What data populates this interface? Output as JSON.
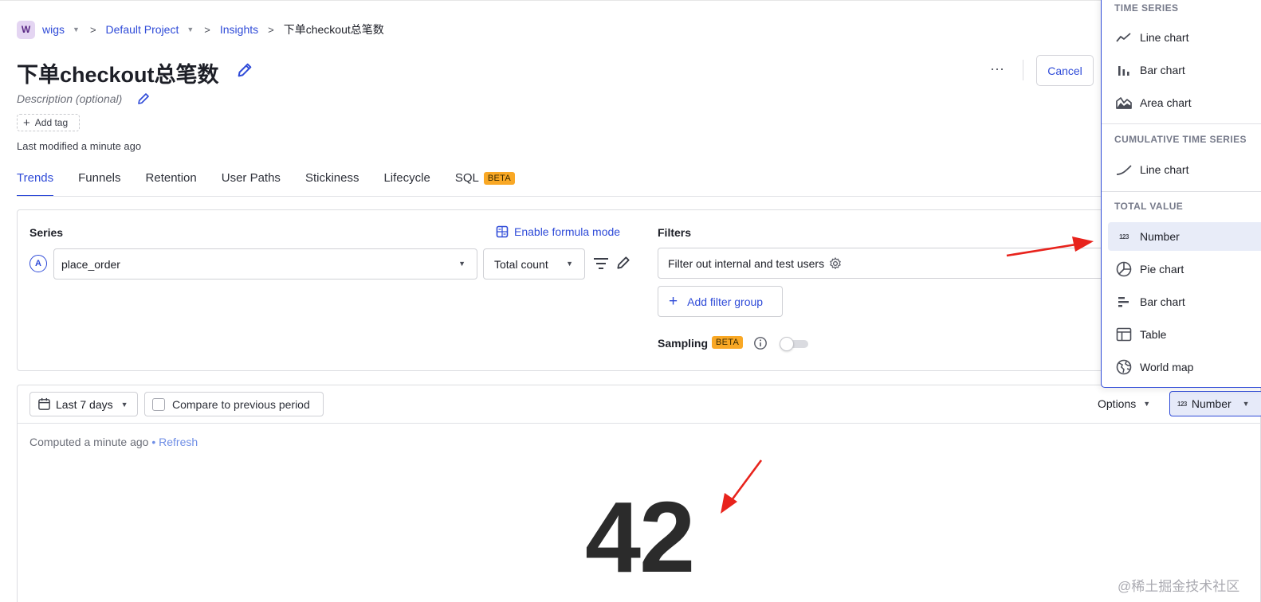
{
  "breadcrumb": {
    "org_initial": "W",
    "org": "wigs",
    "project": "Default Project",
    "section": "Insights",
    "current": "下单checkout总笔数"
  },
  "header": {
    "title": "下单checkout总笔数",
    "description_placeholder": "Description (optional)",
    "add_tag": "Add tag",
    "last_modified": "Last modified a minute ago",
    "more": "···",
    "cancel": "Cancel"
  },
  "tabs": [
    {
      "label": "Trends",
      "active": true
    },
    {
      "label": "Funnels"
    },
    {
      "label": "Retention"
    },
    {
      "label": "User Paths"
    },
    {
      "label": "Stickiness"
    },
    {
      "label": "Lifecycle"
    },
    {
      "label": "SQL",
      "badge": "BETA"
    }
  ],
  "series": {
    "label": "Series",
    "formula_mode": "Enable formula mode",
    "letter": "A",
    "event": "place_order",
    "aggregation": "Total count"
  },
  "filters": {
    "label": "Filters",
    "test_filter": "Filter out internal and test users",
    "add_filter_group": "Add filter group",
    "sampling": "Sampling",
    "sampling_badge": "BETA"
  },
  "results": {
    "date_range": "Last 7 days",
    "compare": "Compare to previous period",
    "options": "Options",
    "display_type": "Number",
    "display_type_icon": "123",
    "computed": "Computed a minute ago",
    "bullet": "•",
    "refresh": "Refresh",
    "value": "42"
  },
  "menu": {
    "sections": [
      {
        "title": "TIME SERIES",
        "items": [
          {
            "label": "Line chart",
            "icon": "line-chart-icon"
          },
          {
            "label": "Bar chart",
            "icon": "bar-chart-icon"
          },
          {
            "label": "Area chart",
            "icon": "area-chart-icon"
          }
        ]
      },
      {
        "title": "CUMULATIVE TIME SERIES",
        "items": [
          {
            "label": "Line chart",
            "icon": "cumulative-line-icon"
          }
        ]
      },
      {
        "title": "TOTAL VALUE",
        "items": [
          {
            "label": "Number",
            "icon": "number-icon",
            "selected": true
          },
          {
            "label": "Pie chart",
            "icon": "pie-chart-icon"
          },
          {
            "label": "Bar chart",
            "icon": "horizontal-bar-icon"
          },
          {
            "label": "Table",
            "icon": "table-icon"
          },
          {
            "label": "World map",
            "icon": "globe-icon"
          }
        ]
      }
    ]
  },
  "watermark": "@稀土掘金技术社区",
  "colors": {
    "accent": "#2f4bd8",
    "beta": "#f9a825",
    "annotation_arrow": "#e8231c"
  }
}
